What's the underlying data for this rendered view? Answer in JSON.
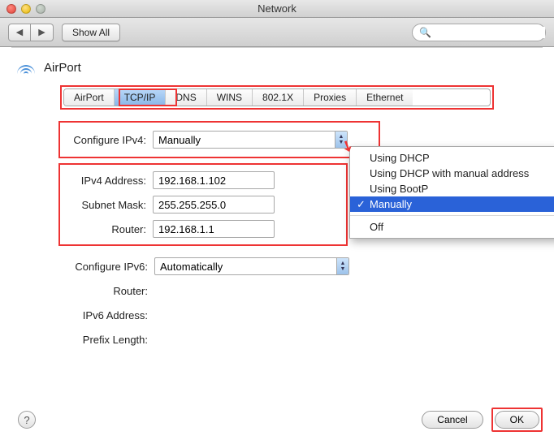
{
  "window": {
    "title": "Network"
  },
  "toolbar": {
    "show_all": "Show All",
    "search_placeholder": ""
  },
  "header": {
    "interface": "AirPort"
  },
  "tabs": {
    "items": [
      "AirPort",
      "TCP/IP",
      "DNS",
      "WINS",
      "802.1X",
      "Proxies",
      "Ethernet"
    ],
    "selected": "TCP/IP"
  },
  "ipv4": {
    "configure_label": "Configure IPv4:",
    "configure_value": "Manually",
    "address_label": "IPv4 Address:",
    "address_value": "192.168.1.102",
    "subnet_label": "Subnet Mask:",
    "subnet_value": "255.255.255.0",
    "router_label": "Router:",
    "router_value": "192.168.1.1"
  },
  "ipv6": {
    "configure_label": "Configure IPv6:",
    "configure_value": "Automatically",
    "router_label": "Router:",
    "address_label": "IPv6 Address:",
    "prefix_label": "Prefix Length:"
  },
  "menu": {
    "items": [
      "Using DHCP",
      "Using DHCP with manual address",
      "Using BootP",
      "Manually",
      "Off"
    ],
    "selected": "Manually"
  },
  "buttons": {
    "cancel": "Cancel",
    "ok": "OK",
    "help": "?"
  }
}
